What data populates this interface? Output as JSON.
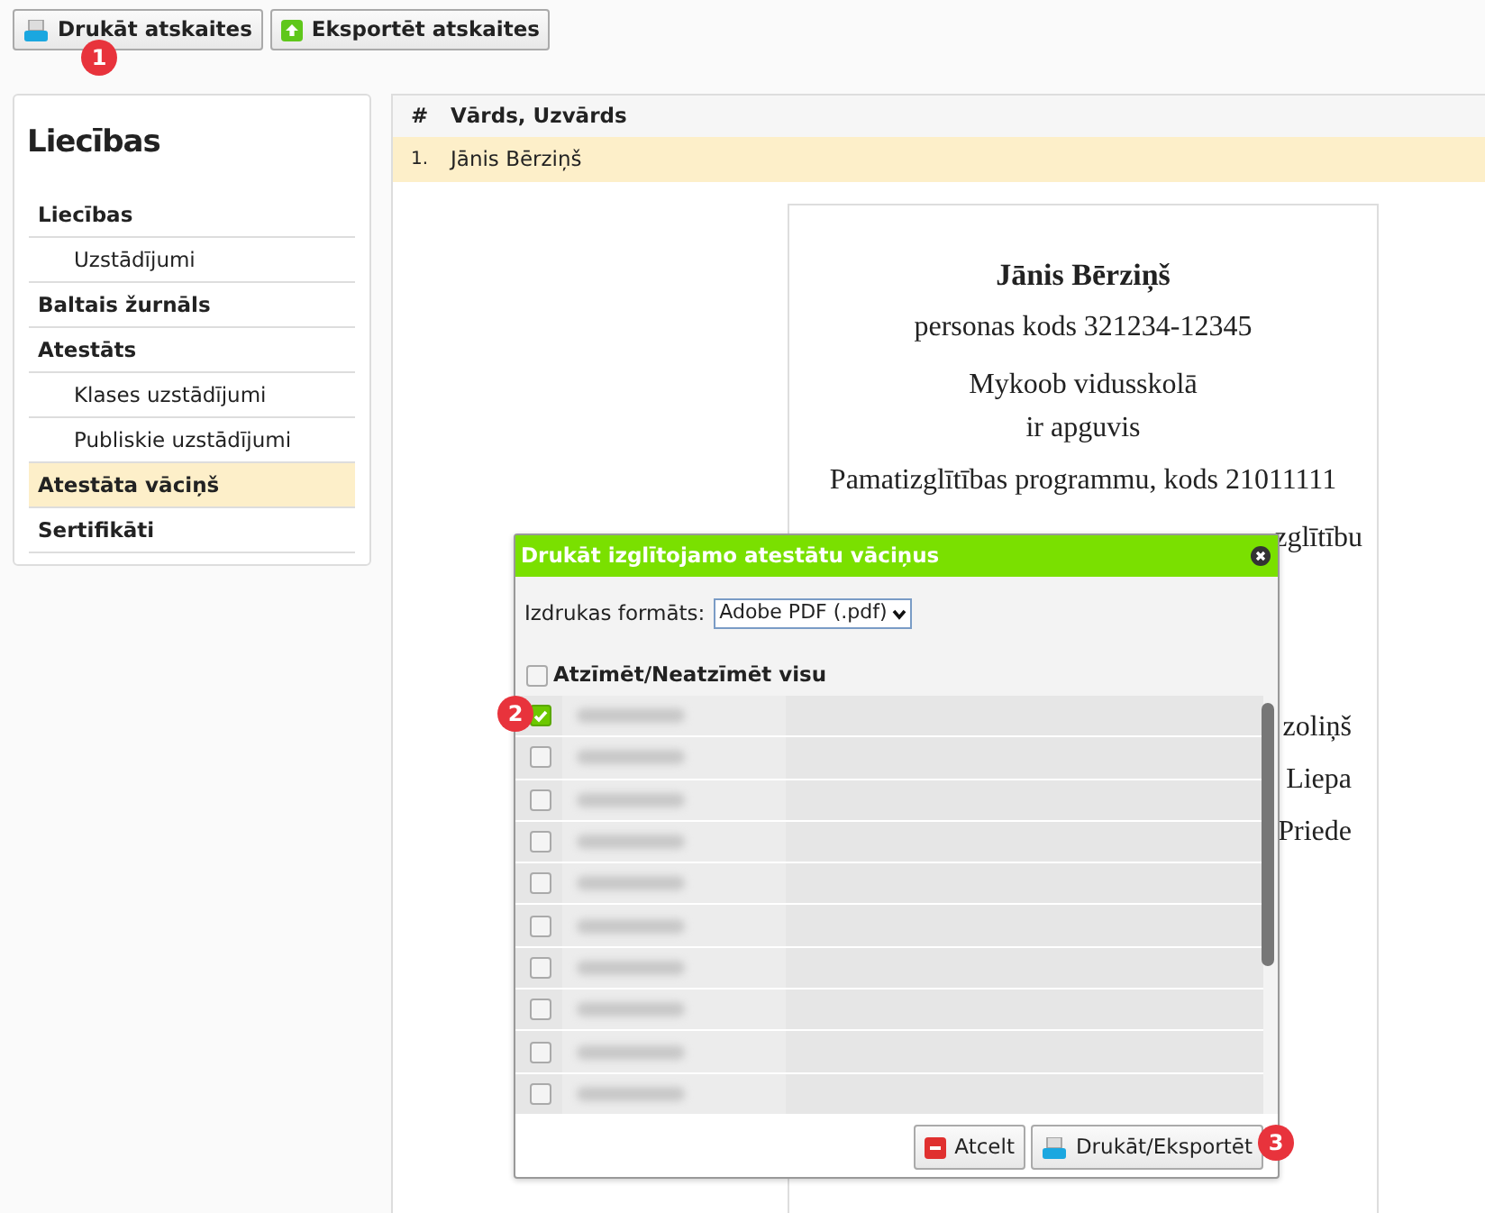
{
  "toolbar": {
    "buttons": [
      {
        "label": "Drukāt atskaites",
        "kind": "print"
      },
      {
        "label": "Eksportēt atskaites",
        "kind": "export"
      }
    ]
  },
  "sidebar": {
    "title": "Liecības",
    "items": [
      {
        "label": "Liecības",
        "selected": false,
        "children": [
          {
            "label": "Uzstādījumi",
            "selected": false
          }
        ]
      },
      {
        "label": "Baltais žurnāls",
        "selected": false
      },
      {
        "label": "Atestāts",
        "selected": false,
        "children": [
          {
            "label": "Klases uzstādījumi",
            "selected": false
          },
          {
            "label": "Publiskie uzstādījumi",
            "selected": false
          }
        ]
      },
      {
        "label": "Atestāta vāciņš",
        "selected": true
      },
      {
        "label": "Sertifikāti",
        "selected": false
      }
    ]
  },
  "table": {
    "columns": [
      "#",
      "Vārds, Uzvārds"
    ],
    "rows": [
      {
        "cells": [
          "1.",
          "Jānis Bērziņš"
        ],
        "selected": true
      }
    ]
  },
  "document": {
    "name": "Jānis Bērziņš",
    "lines": [
      "personas kods 321234-12345",
      "Mykoob vidusskolā",
      "ir apguvis",
      "Pamatizglītības programmu, kods 21011111"
    ],
    "covered_fragments": [
      "zglītību",
      "zoliņš",
      "Liepa",
      "Priede"
    ]
  },
  "dialog": {
    "title": "Drukāt izglītojamo atestātu vāciņus",
    "format_label": "Izdrukas formāts:",
    "format_value": "Adobe PDF (.pdf)",
    "select_all": {
      "label": "Atzīmēt/Neatzīmēt visu",
      "checked": false
    },
    "students": [
      {
        "checked": true
      },
      {
        "checked": false
      },
      {
        "checked": false
      },
      {
        "checked": false
      },
      {
        "checked": false
      },
      {
        "checked": false
      },
      {
        "checked": false
      },
      {
        "checked": false
      },
      {
        "checked": false
      },
      {
        "checked": false
      }
    ],
    "buttons": [
      {
        "label": "Atcelt",
        "kind": "cancel"
      },
      {
        "label": "Drukāt/Eksportēt",
        "kind": "print"
      }
    ]
  },
  "annotations": [
    {
      "label": "1"
    },
    {
      "label": "2"
    },
    {
      "label": "3"
    }
  ]
}
